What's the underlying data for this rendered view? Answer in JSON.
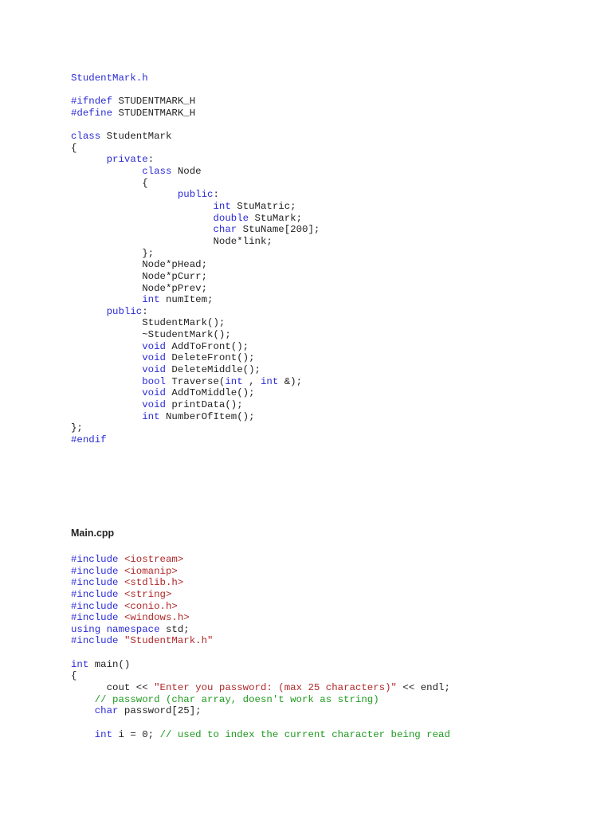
{
  "colors": {
    "keyword": "#2b2bd6",
    "string": "#b0282a",
    "comment": "#1f9a1f",
    "text": "#222222"
  },
  "header_file": {
    "lines": [
      [
        [
          "StudentMark.h",
          "ttl"
        ]
      ],
      [],
      [
        [
          "#ifndef",
          "kw"
        ],
        [
          " STUDENTMARK_H",
          "pl"
        ]
      ],
      [
        [
          "#define",
          "kw"
        ],
        [
          " STUDENTMARK_H",
          "pl"
        ]
      ],
      [],
      [
        [
          "class",
          "kw"
        ],
        [
          " StudentMark",
          "pl"
        ]
      ],
      [
        [
          "{",
          "pl"
        ]
      ],
      [
        [
          "\t",
          "pl"
        ],
        [
          "private",
          "kw"
        ],
        [
          ":",
          "pl"
        ]
      ],
      [
        [
          "\t\t",
          "pl"
        ],
        [
          "class",
          "kw"
        ],
        [
          " Node",
          "pl"
        ]
      ],
      [
        [
          "\t\t{",
          "pl"
        ]
      ],
      [
        [
          "\t\t\t",
          "pl"
        ],
        [
          "public",
          "kw"
        ],
        [
          ":",
          "pl"
        ]
      ],
      [
        [
          "\t\t\t\t",
          "pl"
        ],
        [
          "int",
          "kw"
        ],
        [
          " StuMatric;",
          "pl"
        ]
      ],
      [
        [
          "\t\t\t\t",
          "pl"
        ],
        [
          "double",
          "kw"
        ],
        [
          " StuMark;",
          "pl"
        ]
      ],
      [
        [
          "\t\t\t\t",
          "pl"
        ],
        [
          "char",
          "kw"
        ],
        [
          " StuName[200];",
          "pl"
        ]
      ],
      [
        [
          "\t\t\t\tNode*link;",
          "pl"
        ]
      ],
      [
        [
          "\t\t};",
          "pl"
        ]
      ],
      [
        [
          "\t\tNode*pHead;",
          "pl"
        ]
      ],
      [
        [
          "\t\tNode*pCurr;",
          "pl"
        ]
      ],
      [
        [
          "\t\tNode*pPrev;",
          "pl"
        ]
      ],
      [
        [
          "\t\t",
          "pl"
        ],
        [
          "int",
          "kw"
        ],
        [
          " numItem;",
          "pl"
        ]
      ],
      [
        [
          "\t",
          "pl"
        ],
        [
          "public",
          "kw"
        ],
        [
          ":",
          "pl"
        ]
      ],
      [
        [
          "\t\tStudentMark();",
          "pl"
        ]
      ],
      [
        [
          "\t\t~StudentMark();",
          "pl"
        ]
      ],
      [
        [
          "\t\t",
          "pl"
        ],
        [
          "void",
          "kw"
        ],
        [
          " AddToFront();",
          "pl"
        ]
      ],
      [
        [
          "\t\t",
          "pl"
        ],
        [
          "void",
          "kw"
        ],
        [
          " DeleteFront();",
          "pl"
        ]
      ],
      [
        [
          "\t\t",
          "pl"
        ],
        [
          "void",
          "kw"
        ],
        [
          " DeleteMiddle();",
          "pl"
        ]
      ],
      [
        [
          "\t\t",
          "pl"
        ],
        [
          "bool",
          "kw"
        ],
        [
          " Traverse(",
          "pl"
        ],
        [
          "int",
          "kw"
        ],
        [
          " , ",
          "pl"
        ],
        [
          "int",
          "kw"
        ],
        [
          " &);",
          "pl"
        ]
      ],
      [
        [
          "\t\t",
          "pl"
        ],
        [
          "void",
          "kw"
        ],
        [
          " AddToMiddle();",
          "pl"
        ]
      ],
      [
        [
          "\t\t",
          "pl"
        ],
        [
          "void",
          "kw"
        ],
        [
          " printData();",
          "pl"
        ]
      ],
      [
        [
          "\t\t",
          "pl"
        ],
        [
          "int",
          "kw"
        ],
        [
          " NumberOfItem();",
          "pl"
        ]
      ],
      [
        [
          "};",
          "pl"
        ]
      ],
      [
        [
          "#endif",
          "kw"
        ]
      ]
    ]
  },
  "main_file": {
    "heading": "Main.cpp",
    "lines": [
      [
        [
          "#include",
          "kw"
        ],
        [
          " ",
          "pl"
        ],
        [
          "<iostream>",
          "str"
        ]
      ],
      [
        [
          "#include",
          "kw"
        ],
        [
          " ",
          "pl"
        ],
        [
          "<iomanip>",
          "str"
        ]
      ],
      [
        [
          "#include",
          "kw"
        ],
        [
          " ",
          "pl"
        ],
        [
          "<stdlib.h>",
          "str"
        ]
      ],
      [
        [
          "#include",
          "kw"
        ],
        [
          " ",
          "pl"
        ],
        [
          "<string>",
          "str"
        ]
      ],
      [
        [
          "#include",
          "kw"
        ],
        [
          " ",
          "pl"
        ],
        [
          "<conio.h>",
          "str"
        ]
      ],
      [
        [
          "#include",
          "kw"
        ],
        [
          " ",
          "pl"
        ],
        [
          "<windows.h>",
          "str"
        ]
      ],
      [
        [
          "using",
          "kw"
        ],
        [
          " ",
          "pl"
        ],
        [
          "namespace",
          "kw"
        ],
        [
          " std;",
          "pl"
        ]
      ],
      [
        [
          "#include",
          "kw"
        ],
        [
          " ",
          "pl"
        ],
        [
          "\"StudentMark.h\"",
          "str"
        ]
      ],
      [],
      [
        [
          "int",
          "kw"
        ],
        [
          " main()",
          "pl"
        ]
      ],
      [
        [
          "{",
          "pl"
        ]
      ],
      [
        [
          "\tcout << ",
          "pl"
        ],
        [
          "\"Enter you password: (max 25 characters)\"",
          "str"
        ],
        [
          " << endl;",
          "pl"
        ]
      ],
      [
        [
          "    ",
          "pl"
        ],
        [
          "// password (char array, doesn't work as string)",
          "cm"
        ]
      ],
      [
        [
          "    ",
          "pl"
        ],
        [
          "char",
          "kw"
        ],
        [
          " password[25];",
          "pl"
        ]
      ],
      [],
      [
        [
          "    ",
          "pl"
        ],
        [
          "int",
          "kw"
        ],
        [
          " i = 0; ",
          "pl"
        ],
        [
          "// used to index the current character being read",
          "cm"
        ]
      ]
    ]
  }
}
